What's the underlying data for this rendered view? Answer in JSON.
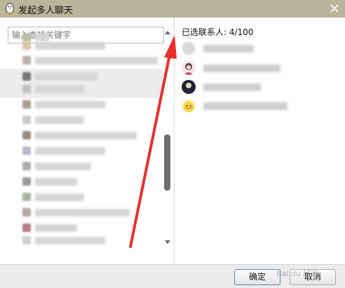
{
  "window": {
    "title": "发起多人聊天",
    "icon": "qq-penguin-icon",
    "close_icon": "close-icon"
  },
  "search": {
    "placeholder": "输入查找关键字",
    "value": ""
  },
  "selected": {
    "label": "已选联系人: 4/100"
  },
  "buttons": {
    "ok": "确定",
    "cancel": "取消"
  },
  "watermark": "Bai du 经验",
  "colors": {
    "titlebar": "#b9b49a",
    "annotation_arrow": "#e8302b",
    "scroll_thumb": "#6e6e6e"
  }
}
